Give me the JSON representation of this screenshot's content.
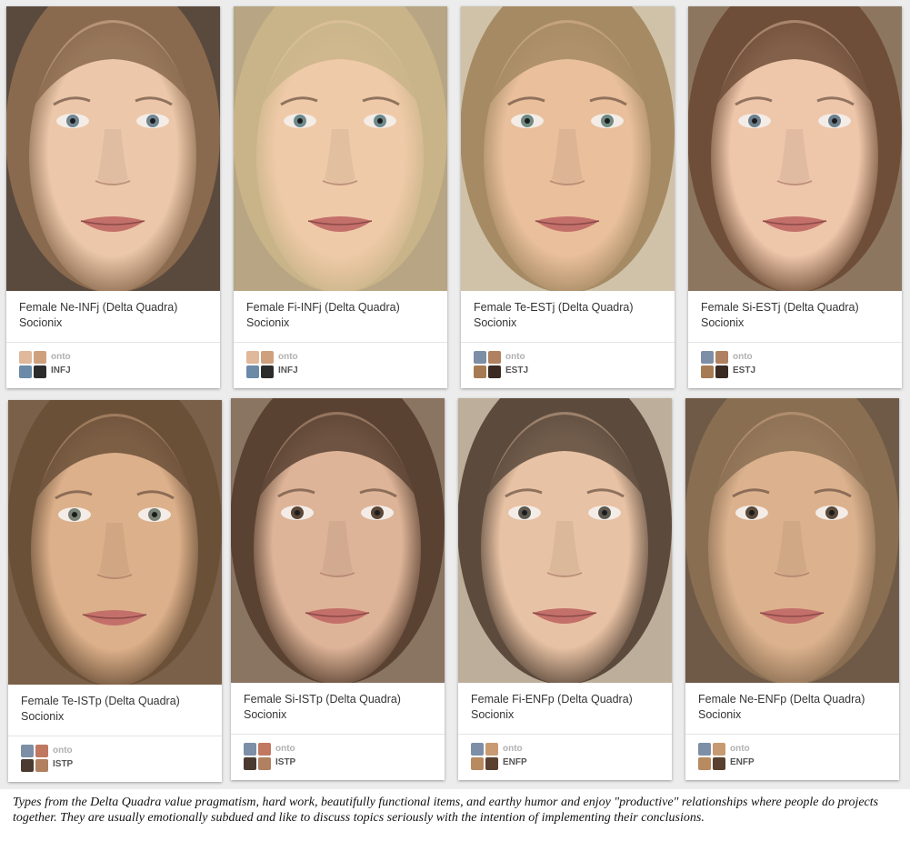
{
  "cards": [
    {
      "title": "Female Ne-INFj (Delta Quadra)",
      "source": "Socionix",
      "user": "onto",
      "board": "INFJ",
      "skin": "#ecc7a9",
      "hair": "#8a6a4e",
      "bg": "#5a4a3e",
      "eye": "#6f8591",
      "thumb_colors": [
        "#e0b89a",
        "#cfa07e",
        "#6a8aa8",
        "#2c2c2c"
      ]
    },
    {
      "title": "Female Fi-INFj (Delta Quadra)",
      "source": "Socionix",
      "user": "onto",
      "board": "INFJ",
      "skin": "#efcaa8",
      "hair": "#c9b489",
      "bg": "#b7a583",
      "eye": "#6d8a8e",
      "thumb_colors": [
        "#e0b89a",
        "#cfa07e",
        "#6a8aa8",
        "#2c2c2c"
      ]
    },
    {
      "title": "Female Te-ESTj (Delta Quadra)",
      "source": "Socionix",
      "user": "onto",
      "board": "ESTJ",
      "skin": "#e9bf9c",
      "hair": "#a58a63",
      "bg": "#cfc2a8",
      "eye": "#6f8a83",
      "thumb_colors": [
        "#7d8fa6",
        "#b08160",
        "#a67a52",
        "#3a2a22"
      ]
    },
    {
      "title": "Female Si-ESTj (Delta Quadra)",
      "source": "Socionix",
      "user": "onto",
      "board": "ESTJ",
      "skin": "#eec6aa",
      "hair": "#6e4e38",
      "bg": "#8c7660",
      "eye": "#6c7f8c",
      "thumb_colors": [
        "#7d8fa6",
        "#b08160",
        "#a67a52",
        "#3a2a22"
      ]
    },
    {
      "title": "Female Te-ISTp (Delta Quadra)",
      "source": "Socionix",
      "user": "onto",
      "board": "ISTP",
      "skin": "#dcb08a",
      "hair": "#6b5038",
      "bg": "#7a6048",
      "eye": "#7a8276",
      "thumb_colors": [
        "#7d8fa6",
        "#c07860",
        "#4a3a30",
        "#b08060"
      ]
    },
    {
      "title": "Female Si-ISTp (Delta Quadra)",
      "source": "Socionix",
      "user": "onto",
      "board": "ISTP",
      "skin": "#deb498",
      "hair": "#5a4232",
      "bg": "#8a7462",
      "eye": "#5a4636",
      "thumb_colors": [
        "#7d8fa6",
        "#c07860",
        "#4a3a30",
        "#b08060"
      ]
    },
    {
      "title": "Female Fi-ENFp (Delta Quadra)",
      "source": "Socionix",
      "user": "onto",
      "board": "ENFP",
      "skin": "#e8c2a4",
      "hair": "#5c4a3c",
      "bg": "#bcae9a",
      "eye": "#5e5a50",
      "thumb_colors": [
        "#7d8fa6",
        "#c89a72",
        "#b88a60",
        "#5a4030"
      ]
    },
    {
      "title": "Female Ne-ENFp (Delta Quadra)",
      "source": "Socionix",
      "user": "onto",
      "board": "ENFP",
      "skin": "#dcb28e",
      "hair": "#8a6e52",
      "bg": "#6e5a46",
      "eye": "#5a4a3a",
      "thumb_colors": [
        "#7d8fa6",
        "#c89a72",
        "#b88a60",
        "#5a4030"
      ]
    }
  ],
  "description": "Types from the Delta Quadra value pragmatism, hard work, beautifully functional items, and earthy humor and enjoy \"productive\" relationships where people do projects together. They are usually emotionally subdued and like to discuss topics seriously with the intention of implementing their conclusions."
}
